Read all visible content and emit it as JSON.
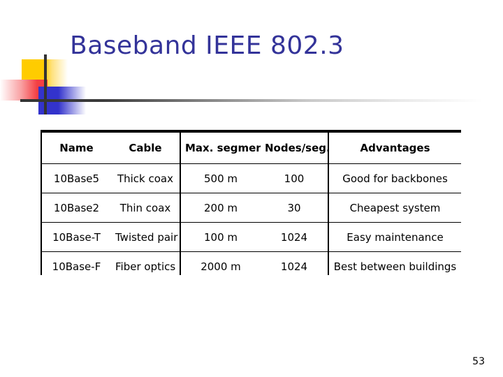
{
  "slide": {
    "title": "Baseband IEEE 802.3",
    "page_number": "53",
    "title_color": "#333399",
    "decor": {
      "yellow": "#FFCC00",
      "red": "#F43F43",
      "blue": "#3333CC",
      "rule": "#333333"
    }
  },
  "table": {
    "headers": [
      "Name",
      "Cable",
      "Max. segment",
      "Nodes/seg.",
      "Advantages"
    ],
    "rows": [
      {
        "name": "10Base5",
        "cable": "Thick coax",
        "max_segment": "500 m",
        "nodes_per_seg": "100",
        "advantages": "Good for backbones"
      },
      {
        "name": "10Base2",
        "cable": "Thin coax",
        "max_segment": "200 m",
        "nodes_per_seg": "30",
        "advantages": "Cheapest system"
      },
      {
        "name": "10Base-T",
        "cable": "Twisted pair",
        "max_segment": "100 m",
        "nodes_per_seg": "1024",
        "advantages": "Easy maintenance"
      },
      {
        "name": "10Base-F",
        "cable": "Fiber optics",
        "max_segment": "2000 m",
        "nodes_per_seg": "1024",
        "advantages": "Best between buildings"
      }
    ]
  }
}
